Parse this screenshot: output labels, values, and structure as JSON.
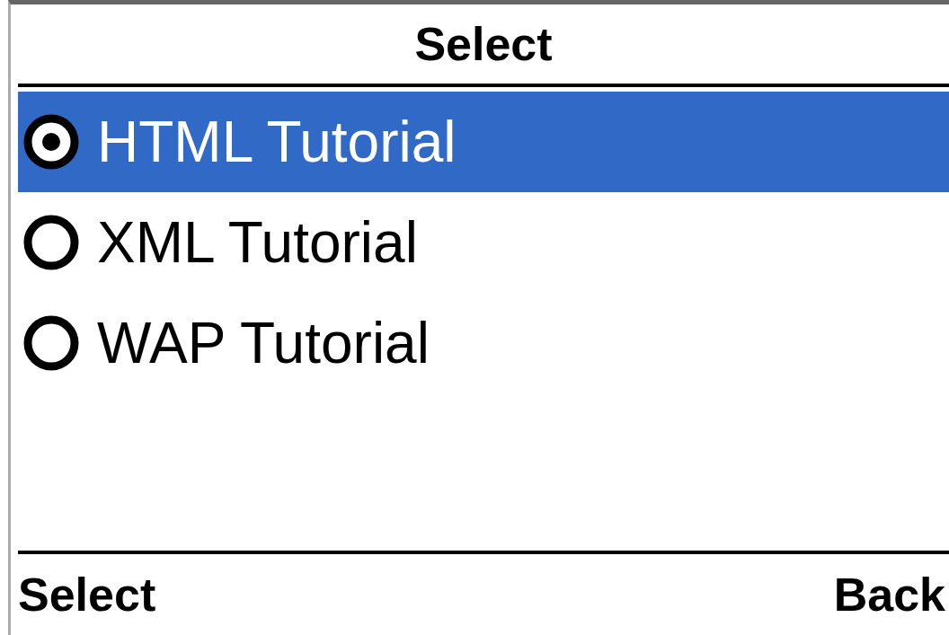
{
  "title": "Select",
  "options": [
    {
      "label": "HTML Tutorial",
      "selected": true
    },
    {
      "label": "XML Tutorial",
      "selected": false
    },
    {
      "label": "WAP Tutorial",
      "selected": false
    }
  ],
  "softkeys": {
    "left": "Select",
    "right": "Back"
  }
}
